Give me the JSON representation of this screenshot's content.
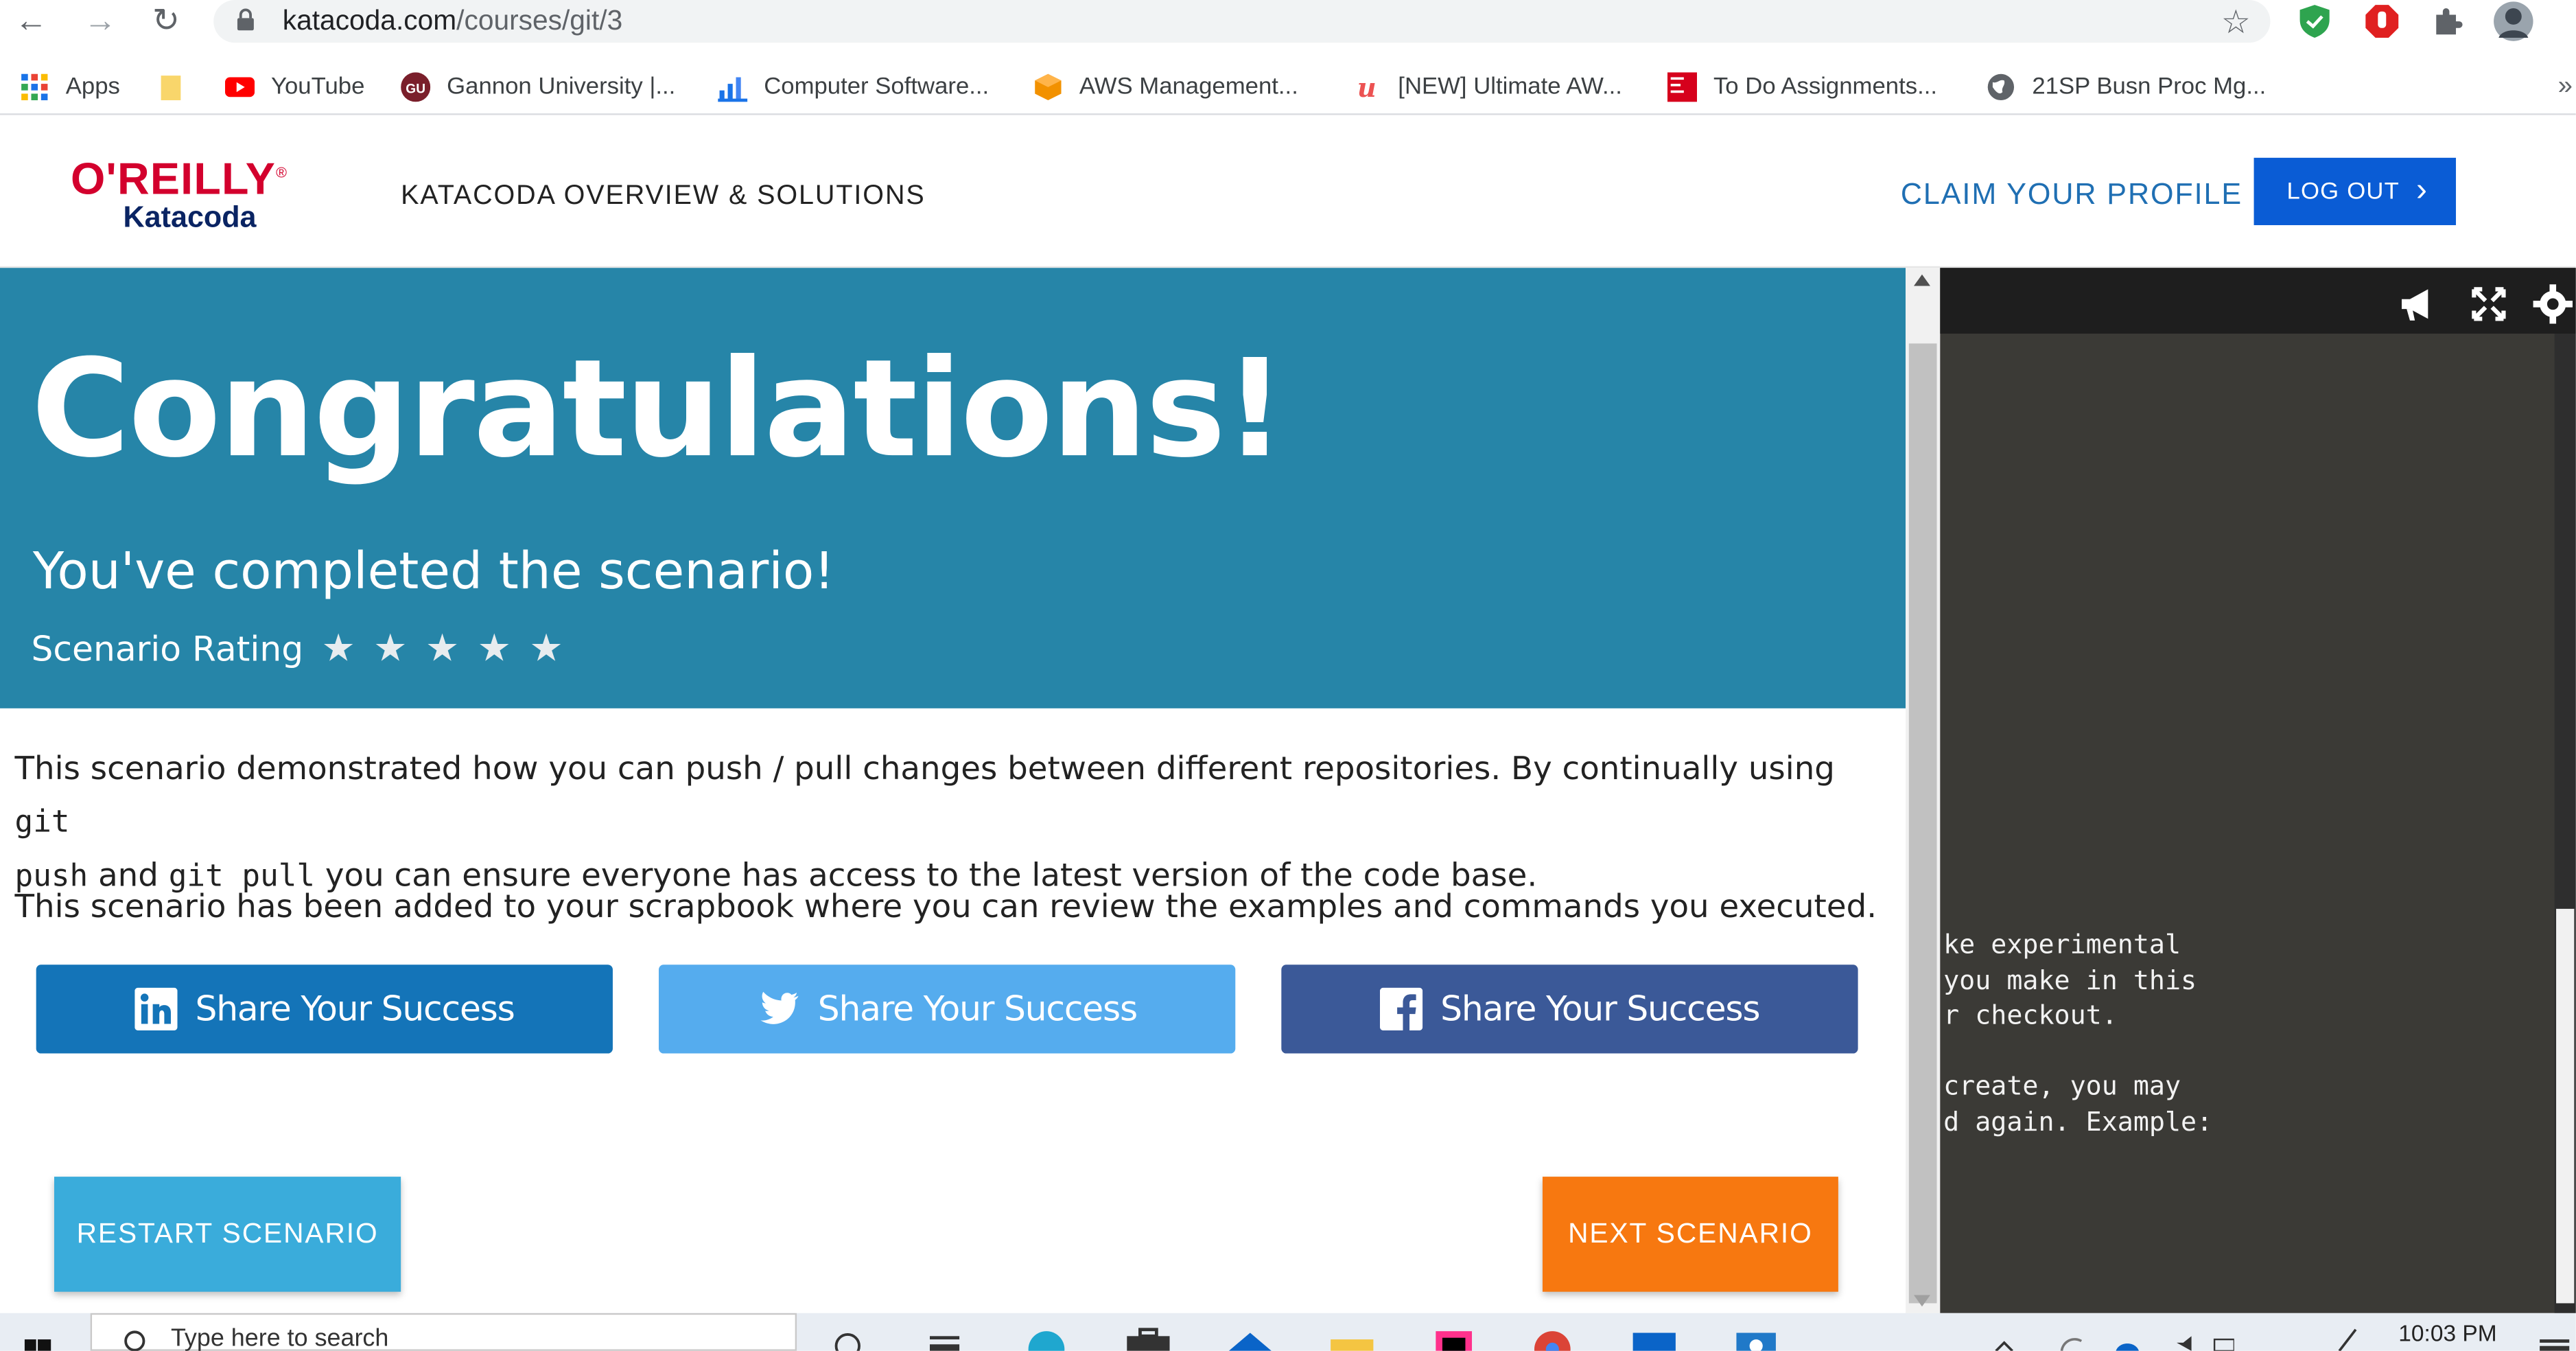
{
  "browser": {
    "url_host": "katacoda.com",
    "url_path": "/courses/git/3",
    "bookmarks": [
      {
        "label": "Apps",
        "icon": "apps-grid-icon"
      },
      {
        "label": "",
        "icon": "folder-icon"
      },
      {
        "label": "YouTube",
        "icon": "youtube-icon"
      },
      {
        "label": "Gannon University |...",
        "icon": "gannon-icon"
      },
      {
        "label": "Computer Software...",
        "icon": "chart-icon"
      },
      {
        "label": "AWS Management...",
        "icon": "aws-icon"
      },
      {
        "label": "[NEW] Ultimate AW...",
        "icon": "udemy-icon"
      },
      {
        "label": "To Do Assignments...",
        "icon": "mcgraw-hill-icon"
      },
      {
        "label": "21SP Busn Proc Mg...",
        "icon": "globe-icon"
      }
    ]
  },
  "header": {
    "logo_top": "O'REILLY",
    "logo_bottom": "Katacoda",
    "nav_overview": "KATACODA OVERVIEW & SOLUTIONS",
    "claim_profile": "CLAIM YOUR PROFILE",
    "logout": "LOG OUT"
  },
  "hero": {
    "title": "Congratulations!",
    "subtitle": "You've completed the scenario!",
    "rating_label": "Scenario Rating",
    "rating_stars": 5
  },
  "body": {
    "p1_a": "This scenario demonstrated how you can push / pull changes between different repositories. By continually using ",
    "p1_code1": "git",
    "p1_b": "push",
    "p1_c": " and ",
    "p1_code2": "git  pull",
    "p1_d": " you can ensure everyone has access to the latest version of the code base.",
    "p2": "This scenario has been added to your scrapbook where you can review the examples and commands you executed."
  },
  "share": {
    "linkedin": "Share Your Success",
    "twitter": "Share Your Success",
    "facebook": "Share Your Success"
  },
  "actions": {
    "restart": "RESTART SCENARIO",
    "next": "NEXT SCENARIO"
  },
  "terminal": {
    "lines": "ke experimental\nyou make in this\nr checkout.\n\ncreate, you may\nd again. Example:"
  },
  "taskbar": {
    "search_placeholder": "Type here to search",
    "time": "10:03 PM"
  },
  "colors": {
    "hero_bg": "#2685a8",
    "logout_bg": "#0a5cd5",
    "restart_bg": "#3aacdb",
    "next_bg": "#f77810",
    "linkedin_bg": "#1474b8",
    "twitter_bg": "#55acee",
    "facebook_bg": "#3b5998",
    "terminal_bg": "#3b3a36"
  }
}
